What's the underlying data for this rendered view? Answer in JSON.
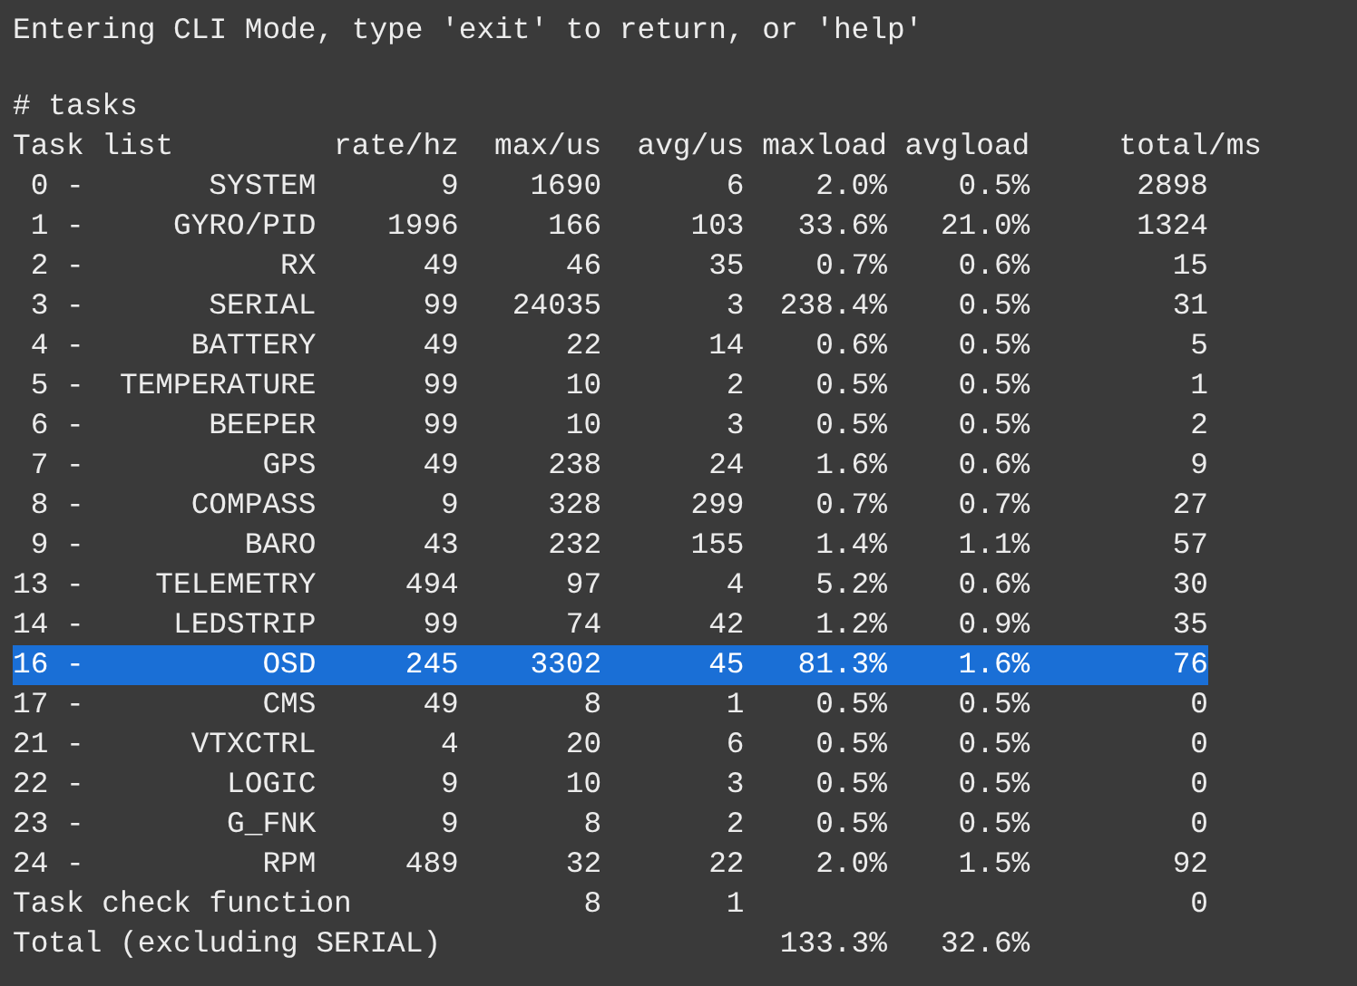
{
  "intro": "Entering CLI Mode, type 'exit' to return, or 'help'",
  "command": "# tasks",
  "header": {
    "label": "Task list",
    "rate": "rate/hz",
    "max": "max/us",
    "avg": "avg/us",
    "maxload": "maxload",
    "avgload": "avgload",
    "total": "total/ms"
  },
  "rows": [
    {
      "id": "0 -",
      "name": "SYSTEM",
      "rate": "9",
      "max": "1690",
      "avg": "6",
      "maxload": "2.0%",
      "avgload": "0.5%",
      "total": "2898",
      "selected": false
    },
    {
      "id": "1 -",
      "name": "GYRO/PID",
      "rate": "1996",
      "max": "166",
      "avg": "103",
      "maxload": "33.6%",
      "avgload": "21.0%",
      "total": "1324",
      "selected": false
    },
    {
      "id": "2 -",
      "name": "RX",
      "rate": "49",
      "max": "46",
      "avg": "35",
      "maxload": "0.7%",
      "avgload": "0.6%",
      "total": "15",
      "selected": false
    },
    {
      "id": "3 -",
      "name": "SERIAL",
      "rate": "99",
      "max": "24035",
      "avg": "3",
      "maxload": "238.4%",
      "avgload": "0.5%",
      "total": "31",
      "selected": false
    },
    {
      "id": "4 -",
      "name": "BATTERY",
      "rate": "49",
      "max": "22",
      "avg": "14",
      "maxload": "0.6%",
      "avgload": "0.5%",
      "total": "5",
      "selected": false
    },
    {
      "id": "5 -",
      "name": "TEMPERATURE",
      "rate": "99",
      "max": "10",
      "avg": "2",
      "maxload": "0.5%",
      "avgload": "0.5%",
      "total": "1",
      "selected": false
    },
    {
      "id": "6 -",
      "name": "BEEPER",
      "rate": "99",
      "max": "10",
      "avg": "3",
      "maxload": "0.5%",
      "avgload": "0.5%",
      "total": "2",
      "selected": false
    },
    {
      "id": "7 -",
      "name": "GPS",
      "rate": "49",
      "max": "238",
      "avg": "24",
      "maxload": "1.6%",
      "avgload": "0.6%",
      "total": "9",
      "selected": false
    },
    {
      "id": "8 -",
      "name": "COMPASS",
      "rate": "9",
      "max": "328",
      "avg": "299",
      "maxload": "0.7%",
      "avgload": "0.7%",
      "total": "27",
      "selected": false
    },
    {
      "id": "9 -",
      "name": "BARO",
      "rate": "43",
      "max": "232",
      "avg": "155",
      "maxload": "1.4%",
      "avgload": "1.1%",
      "total": "57",
      "selected": false
    },
    {
      "id": "13 -",
      "name": "TELEMETRY",
      "rate": "494",
      "max": "97",
      "avg": "4",
      "maxload": "5.2%",
      "avgload": "0.6%",
      "total": "30",
      "selected": false
    },
    {
      "id": "14 -",
      "name": "LEDSTRIP",
      "rate": "99",
      "max": "74",
      "avg": "42",
      "maxload": "1.2%",
      "avgload": "0.9%",
      "total": "35",
      "selected": false
    },
    {
      "id": "16 -",
      "name": "OSD",
      "rate": "245",
      "max": "3302",
      "avg": "45",
      "maxload": "81.3%",
      "avgload": "1.6%",
      "total": "76",
      "selected": true
    },
    {
      "id": "17 -",
      "name": "CMS",
      "rate": "49",
      "max": "8",
      "avg": "1",
      "maxload": "0.5%",
      "avgload": "0.5%",
      "total": "0",
      "selected": false
    },
    {
      "id": "21 -",
      "name": "VTXCTRL",
      "rate": "4",
      "max": "20",
      "avg": "6",
      "maxload": "0.5%",
      "avgload": "0.5%",
      "total": "0",
      "selected": false
    },
    {
      "id": "22 -",
      "name": "LOGIC",
      "rate": "9",
      "max": "10",
      "avg": "3",
      "maxload": "0.5%",
      "avgload": "0.5%",
      "total": "0",
      "selected": false
    },
    {
      "id": "23 -",
      "name": "G_FNK",
      "rate": "9",
      "max": "8",
      "avg": "2",
      "maxload": "0.5%",
      "avgload": "0.5%",
      "total": "0",
      "selected": false
    },
    {
      "id": "24 -",
      "name": "RPM",
      "rate": "489",
      "max": "32",
      "avg": "22",
      "maxload": "2.0%",
      "avgload": "1.5%",
      "total": "92",
      "selected": false
    }
  ],
  "check": {
    "label": "Task check function",
    "max": "8",
    "avg": "1",
    "total": "0"
  },
  "summary": {
    "label": "Total (excluding SERIAL)",
    "maxload": "133.3%",
    "avgload": "32.6%"
  }
}
